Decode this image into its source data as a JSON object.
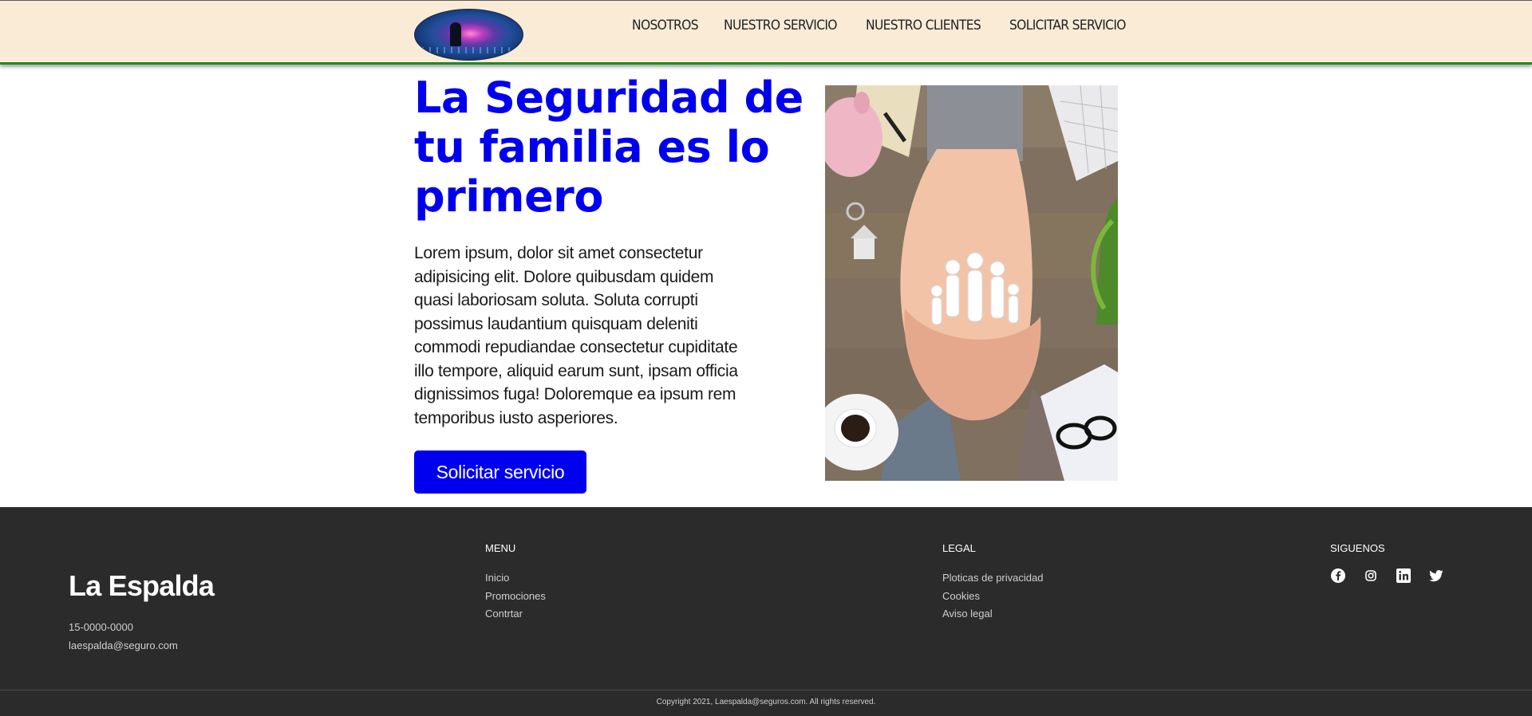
{
  "header": {
    "nav": [
      "NOSOTROS",
      "NUESTRO SERVICIO",
      "NUESTRO CLIENTES",
      "SOLICITAR SERVICIO"
    ]
  },
  "hero": {
    "title": "La Seguridad de tu familia es lo primero",
    "text": "Lorem ipsum, dolor sit amet consectetur adipisicing elit. Dolore quibusdam quidem quasi laboriosam soluta. Soluta corrupti possimus laudantium quisquam deleniti commodi repudiandae consectetur cupiditate illo tempore, aliquid earum sunt, ipsam officia dignissimos fuga! Doloremque ea ipsum rem temporibus iusto asperiores.",
    "button": "Solicitar servicio"
  },
  "footer": {
    "brand": "La Espalda",
    "phone": "15-0000-0000",
    "email": "laespalda@seguro.com",
    "menu": {
      "title": "MENU",
      "items": [
        "Inicio",
        "Promociones",
        "Contrtar"
      ]
    },
    "legal": {
      "title": "LEGAL",
      "items": [
        "Ploticas de privacidad",
        "Cookies",
        "Aviso legal"
      ]
    },
    "social": {
      "title": "SIGUENOS",
      "icons": [
        "facebook-icon",
        "instagram-icon",
        "linkedin-icon",
        "twitter-icon"
      ]
    },
    "copyright": "Copyright 2021, Laespalda@seguros.com. All rights reserved."
  },
  "colors": {
    "header_bg": "#faebd7",
    "header_border": "#1f8a1f",
    "accent": "#0000ee",
    "footer_bg": "#2b2b2b"
  }
}
